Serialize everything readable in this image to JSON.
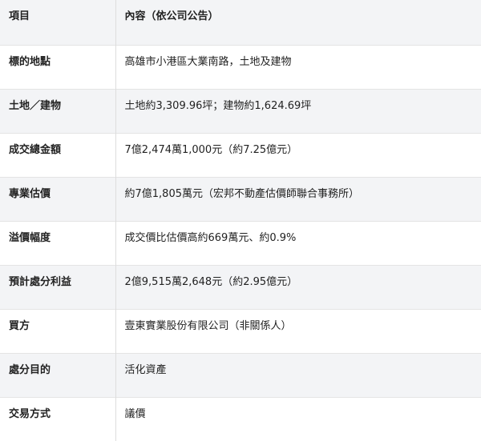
{
  "table": {
    "header": {
      "col1": "項目",
      "col2": "內容（依公司公告）"
    },
    "rows": [
      {
        "label": "標的地點",
        "value": "高雄市小港區大業南路，土地及建物"
      },
      {
        "label": "土地／建物",
        "value": "土地約3,309.96坪；建物約1,624.69坪"
      },
      {
        "label": "成交總金額",
        "value": "7億2,474萬1,000元（約7.25億元）"
      },
      {
        "label": "專業估價",
        "value": "約7億1,805萬元（宏邦不動產估價師聯合事務所）"
      },
      {
        "label": "溢價幅度",
        "value": "成交價比估價高約669萬元、約0.9%"
      },
      {
        "label": "預計處分利益",
        "value": "2億9,515萬2,648元（約2.95億元）"
      },
      {
        "label": "買方",
        "value": "壹東實業股份有限公司（非關係人）"
      },
      {
        "label": "處分目的",
        "value": "活化資產"
      },
      {
        "label": "交易方式",
        "value": "議價"
      }
    ]
  },
  "colors": {
    "row_shade": "#f3f4f6",
    "row_plain": "#ffffff",
    "divider": "#dddddd",
    "text": "#222222"
  }
}
